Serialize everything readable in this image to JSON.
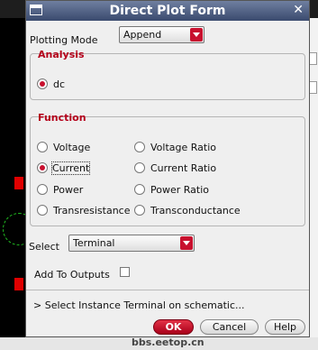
{
  "window": {
    "title": "Direct Plot Form"
  },
  "plotting_mode": {
    "label": "Plotting Mode",
    "value": "Append"
  },
  "analysis": {
    "title": "Analysis",
    "options": [
      {
        "label": "dc",
        "selected": true
      }
    ]
  },
  "function": {
    "title": "Function",
    "left": [
      {
        "label": "Voltage",
        "selected": false
      },
      {
        "label": "Current",
        "selected": true
      },
      {
        "label": "Power",
        "selected": false
      },
      {
        "label": "Transresistance",
        "selected": false
      }
    ],
    "right": [
      {
        "label": "Voltage Ratio",
        "selected": false
      },
      {
        "label": "Current Ratio",
        "selected": false
      },
      {
        "label": "Power Ratio",
        "selected": false
      },
      {
        "label": "Transconductance",
        "selected": false
      }
    ]
  },
  "select": {
    "label": "Select",
    "value": "Terminal"
  },
  "add_to_outputs": {
    "label": "Add To Outputs",
    "checked": false
  },
  "status": "> Select Instance Terminal on schematic...",
  "buttons": {
    "ok": "OK",
    "cancel": "Cancel",
    "help": "Help"
  },
  "watermark": "bbs.eetop.cn",
  "colors": {
    "accent": "#c8102e",
    "title_bar": "#3a4a6e",
    "group_title": "#b5001a"
  }
}
